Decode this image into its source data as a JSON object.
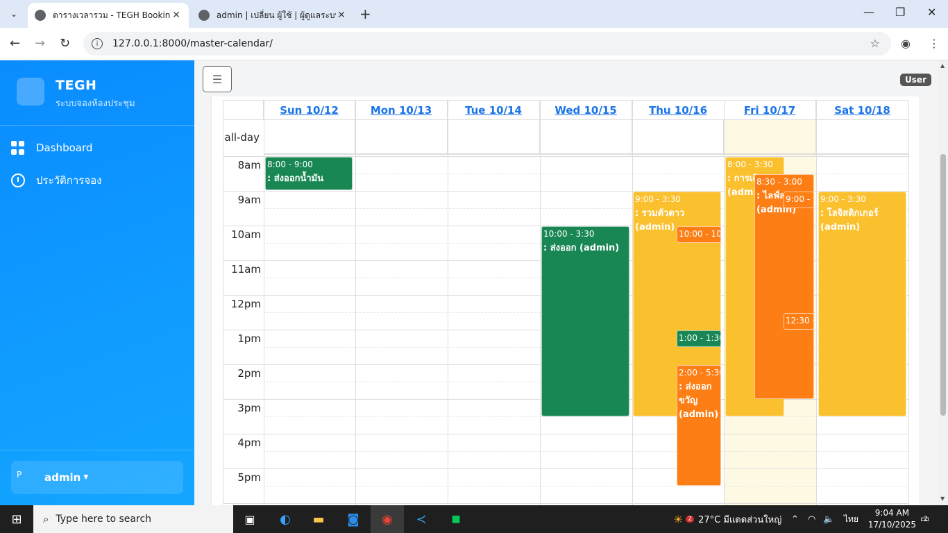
{
  "browser": {
    "tabs": [
      {
        "title": "ตารางเวลารวม - TEGH Booking",
        "active": true
      },
      {
        "title": "admin | เปลี่ยน ผู้ใช้ | ผู้ดูแลระบบ D",
        "active": false
      }
    ],
    "url": "127.0.0.1:8000/master-calendar/"
  },
  "sidebar": {
    "brand_name": "TEGH",
    "brand_sub": "ระบบจองห้องประชุม",
    "items": [
      {
        "label": "Dashboard",
        "icon": "dashboard-grid-icon"
      },
      {
        "label": "ประวัติการจอง",
        "icon": "history-clock-icon"
      }
    ],
    "user": {
      "avatar_alt": "P",
      "name": "admin"
    }
  },
  "header": {
    "menu_icon": "☰",
    "role_badge": "User"
  },
  "calendar": {
    "columns": [
      "Sun 10/12",
      "Mon 10/13",
      "Tue 10/14",
      "Wed 10/15",
      "Thu 10/16",
      "Fri 10/17",
      "Sat 10/18"
    ],
    "allday_label": "all-day",
    "times": [
      "8am",
      "9am",
      "10am",
      "11am",
      "12pm",
      "1pm",
      "2pm",
      "3pm",
      "4pm",
      "5pm"
    ],
    "events": [
      {
        "time": "8:00 - 9:00",
        "name": ": ส่งออกน้ำมัน",
        "color": "green"
      },
      {
        "time": "10:00 - 3:30",
        "name": ": ส่งออก (admin)",
        "color": "green"
      },
      {
        "time": "9:00 - 3:30",
        "name": ": รวมตัวดาว (admin)",
        "color": "yellow"
      },
      {
        "time": "10:00 - 10:3",
        "name": "",
        "color": "orange"
      },
      {
        "time": "1:00 - 1:30",
        "name": "",
        "color": "green"
      },
      {
        "time": "2:00 - 5:30",
        "name": ": ส่งออก ขวัญ (admin)",
        "color": "orange"
      },
      {
        "time": "8:00 - 3:30",
        "name": ": การเดิ (admin",
        "color": "yellow"
      },
      {
        "time": "8:30 - 3:00",
        "name": ": ไลฟ์ส ของ (admin)",
        "color": "orange"
      },
      {
        "time": "9:00 - 9",
        "name": "",
        "color": "orange"
      },
      {
        "time": "12:30 -",
        "name": "",
        "color": "orange"
      },
      {
        "time": "9:00 - 3:30",
        "name": ": โลจิสติกเกอร์ (admin)",
        "color": "yellow"
      }
    ]
  },
  "taskbar": {
    "search_placeholder": "Type here to search",
    "weather_badge": "2",
    "weather": "27°C  มีแดดส่วนใหญ่",
    "lang": "ไทย",
    "time": "9:04 AM",
    "date": "17/10/2025",
    "notif_count": "2"
  }
}
